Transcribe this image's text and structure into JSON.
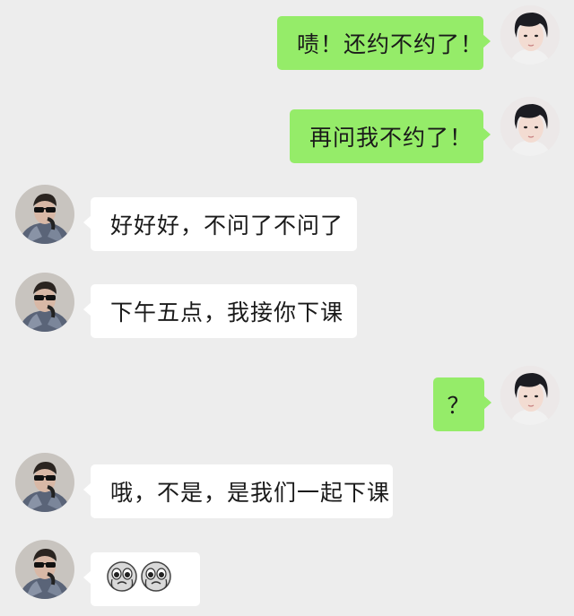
{
  "messages": [
    {
      "side": "right",
      "text": "啧！还约不约了！"
    },
    {
      "side": "right",
      "text": "再问我不约了！"
    },
    {
      "side": "left",
      "text": "好好好，不问了不问了"
    },
    {
      "side": "left",
      "text": "下午五点，我接你下课"
    },
    {
      "side": "right",
      "text": "？"
    },
    {
      "side": "left",
      "text": "哦，不是，是我们一起下课"
    },
    {
      "side": "left",
      "emoji": [
        "crying-emoji",
        "crying-emoji"
      ]
    }
  ],
  "colors": {
    "background": "#ededed",
    "right_bubble": "#95ec69",
    "left_bubble": "#ffffff"
  }
}
